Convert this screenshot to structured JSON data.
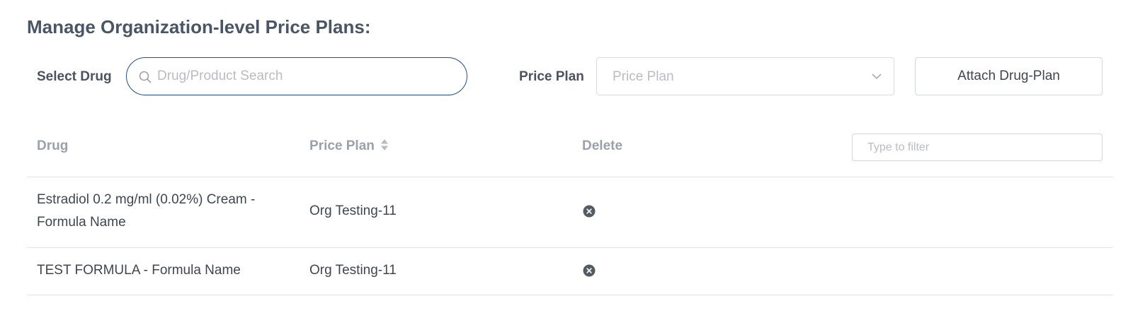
{
  "header": {
    "title": "Manage Organization-level Price Plans:"
  },
  "form": {
    "select_drug_label": "Select Drug",
    "search_placeholder": "Drug/Product Search",
    "price_plan_label": "Price Plan",
    "price_plan_placeholder": "Price Plan",
    "attach_button_label": "Attach Drug-Plan"
  },
  "table": {
    "columns": [
      "Drug",
      "Price Plan",
      "Delete"
    ],
    "filter_placeholder": "Type to filter",
    "rows": [
      {
        "drug": "Estradiol 0.2 mg/ml (0.02%) Cream - Formula Name",
        "price_plan": "Org Testing-11"
      },
      {
        "drug": "TEST FORMULA - Formula Name",
        "price_plan": "Org Testing-11"
      }
    ]
  },
  "icons": {
    "search": "search-icon",
    "dropdown": "chevron-down-icon",
    "sort": "sort-icon",
    "delete": "delete-circle-icon"
  },
  "colors": {
    "accent_border": "#1f4f8f",
    "title_text": "#4a5566",
    "header_text": "#9ba1ab",
    "delete_icon": "#555b63"
  }
}
